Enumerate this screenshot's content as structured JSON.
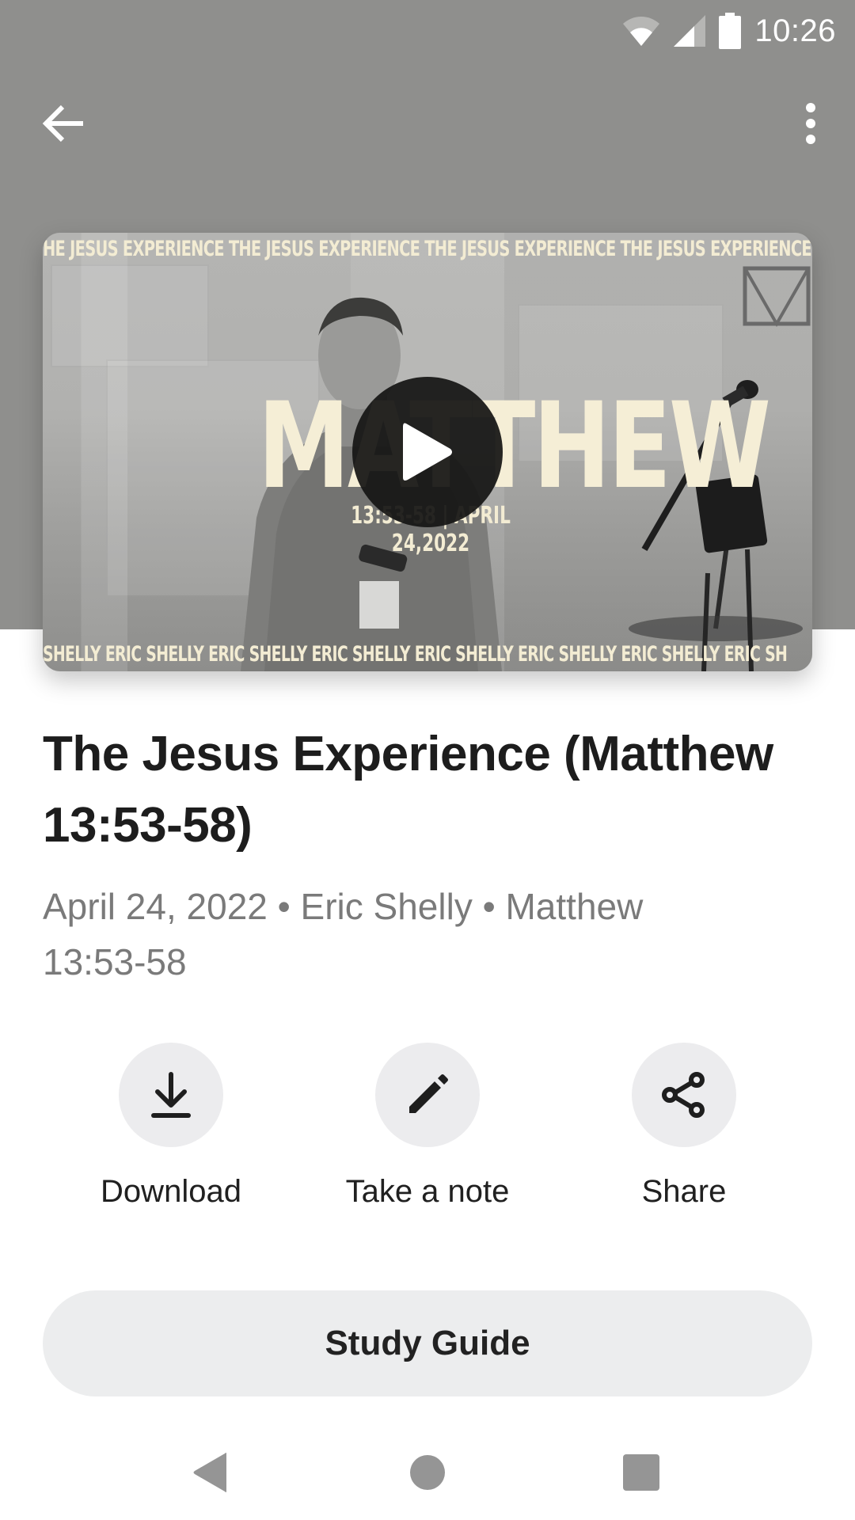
{
  "status_bar": {
    "time": "10:26",
    "icons": [
      "wifi-icon",
      "cellular-signal-icon",
      "battery-icon"
    ]
  },
  "toolbar": {
    "back_icon": "arrow-back-icon",
    "more_icon": "more-vertical-icon"
  },
  "thumbnail": {
    "top_ticker": "HE JESUS EXPERIENCE THE JESUS EXPERIENCE THE JESUS EXPERIENCE THE JESUS EXPERIENCE",
    "big_title": "MATTHEW",
    "subtitle": "13:53-58  |  APRIL 24,2022",
    "bottom_ticker": "SHELLY ERIC SHELLY ERIC SHELLY ERIC SHELLY ERIC SHELLY ERIC SHELLY ERIC SHELLY ERIC SH",
    "play_icon": "play-icon"
  },
  "sermon": {
    "title": "The Jesus Experience (Matthew 13:53-58)",
    "meta": "April 24, 2022 • Eric Shelly • Matthew 13:53-58"
  },
  "actions": [
    {
      "label": "Download",
      "icon": "download-icon"
    },
    {
      "label": "Take a note",
      "icon": "pencil-icon"
    },
    {
      "label": "Share",
      "icon": "share-icon"
    }
  ],
  "study_guide": {
    "label": "Study Guide"
  },
  "nav_bar": {
    "icons": [
      "nav-back-icon",
      "nav-home-icon",
      "nav-recents-icon"
    ]
  },
  "colors": {
    "header_bg": "#8f8f8d",
    "action_circle": "#ececee",
    "title_text": "#1d1d1d",
    "meta_text": "#7a7a7a",
    "thumbnail_text": "#f5eed6"
  }
}
